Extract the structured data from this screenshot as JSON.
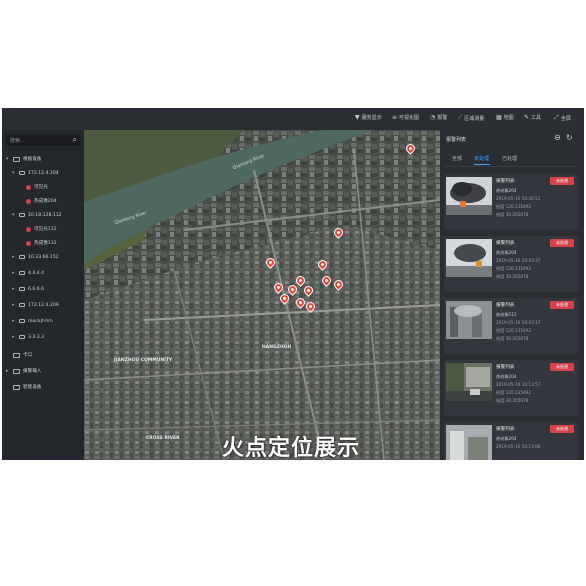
{
  "toolbar": {
    "items": [
      {
        "label": "服务显示",
        "icon": "filter-icon"
      },
      {
        "label": "可视化图",
        "icon": "layers-icon"
      },
      {
        "label": "报警",
        "icon": "alarm-icon"
      },
      {
        "label": "区域测量",
        "icon": "measure-icon"
      },
      {
        "label": "地图",
        "icon": "map-icon"
      },
      {
        "label": "工具",
        "icon": "tools-icon"
      },
      {
        "label": "全屏",
        "icon": "fullscreen-icon"
      }
    ]
  },
  "sidebar": {
    "search_placeholder": "搜索...",
    "tree": [
      {
        "label": "根据设备",
        "level": 0,
        "icon": "monitor-icon",
        "expanded": true
      },
      {
        "label": "172.12.4.204",
        "level": 1,
        "icon": "device-icon",
        "expanded": true
      },
      {
        "label": "可见光",
        "level": 2,
        "icon": "camera-icon"
      },
      {
        "label": "热成像204",
        "level": 2,
        "icon": "camera-icon"
      },
      {
        "label": "10.18.128.112",
        "level": 1,
        "icon": "device-icon",
        "expanded": true
      },
      {
        "label": "可见光112",
        "level": 2,
        "icon": "camera-icon"
      },
      {
        "label": "热成像112",
        "level": 2,
        "icon": "camera-icon"
      },
      {
        "label": "10.33.66.152",
        "level": 1,
        "icon": "device-icon"
      },
      {
        "label": "4.4.4.4",
        "level": 1,
        "icon": "device-icon"
      },
      {
        "label": "6.6.6.6",
        "level": 1,
        "icon": "device-icon"
      },
      {
        "label": "172.12.4.209",
        "level": 1,
        "icon": "device-icon"
      },
      {
        "label": "mockjt-hm",
        "level": 1,
        "icon": "device-icon"
      },
      {
        "label": "3.3.3.3",
        "level": 1,
        "icon": "device-icon"
      },
      {
        "label": "卡口",
        "level": 0,
        "icon": "monitor-icon"
      },
      {
        "label": "报警输入",
        "level": 0,
        "icon": "monitor-icon"
      },
      {
        "label": "智能设备",
        "level": 0,
        "icon": "monitor-icon"
      }
    ]
  },
  "map": {
    "river_labels": [
      "Qiantang River",
      "Qiantang River"
    ],
    "area_labels": [
      "HANGZHOU",
      "JIANZHOU COMMUNITY",
      "CROSS RIVER"
    ],
    "caption": "火点定位展示"
  },
  "panel": {
    "title": "报警列表",
    "tabs": [
      {
        "label": "全部",
        "active": false
      },
      {
        "label": "未处理",
        "active": true
      },
      {
        "label": "已处理",
        "active": false
      }
    ],
    "cards": [
      {
        "title": "报警列表",
        "badge": "未处理",
        "lines": [
          "热成像204",
          "2019-05-16 10:46:51",
          "经度 120.135492",
          "纬度 30.265678"
        ],
        "thumb": "fire"
      },
      {
        "title": "报警列表",
        "badge": "未处理",
        "lines": [
          "热成像204",
          "2019-05-16 10:43:37",
          "经度 120.135492",
          "纬度 30.265678"
        ],
        "thumb": "fire"
      },
      {
        "title": "报警列表",
        "badge": "未处理",
        "lines": [
          "热成像112",
          "2019-05-16 10:43:17",
          "经度 120.135492",
          "纬度 30.265678"
        ],
        "thumb": "smoke"
      },
      {
        "title": "报警列表",
        "badge": "未处理",
        "lines": [
          "热成像204",
          "2019-05-16 10:13:57",
          "经度 120.135492",
          "纬度 30.265678"
        ],
        "thumb": "street"
      },
      {
        "title": "报警列表",
        "badge": "未处理",
        "lines": [
          "热成像204",
          "2019-05-16 10:13:06"
        ],
        "thumb": "building"
      }
    ]
  },
  "colors": {
    "alarm": "#d8434a",
    "accent": "#3ea7ff",
    "panel_bg": "#2a2d32"
  }
}
